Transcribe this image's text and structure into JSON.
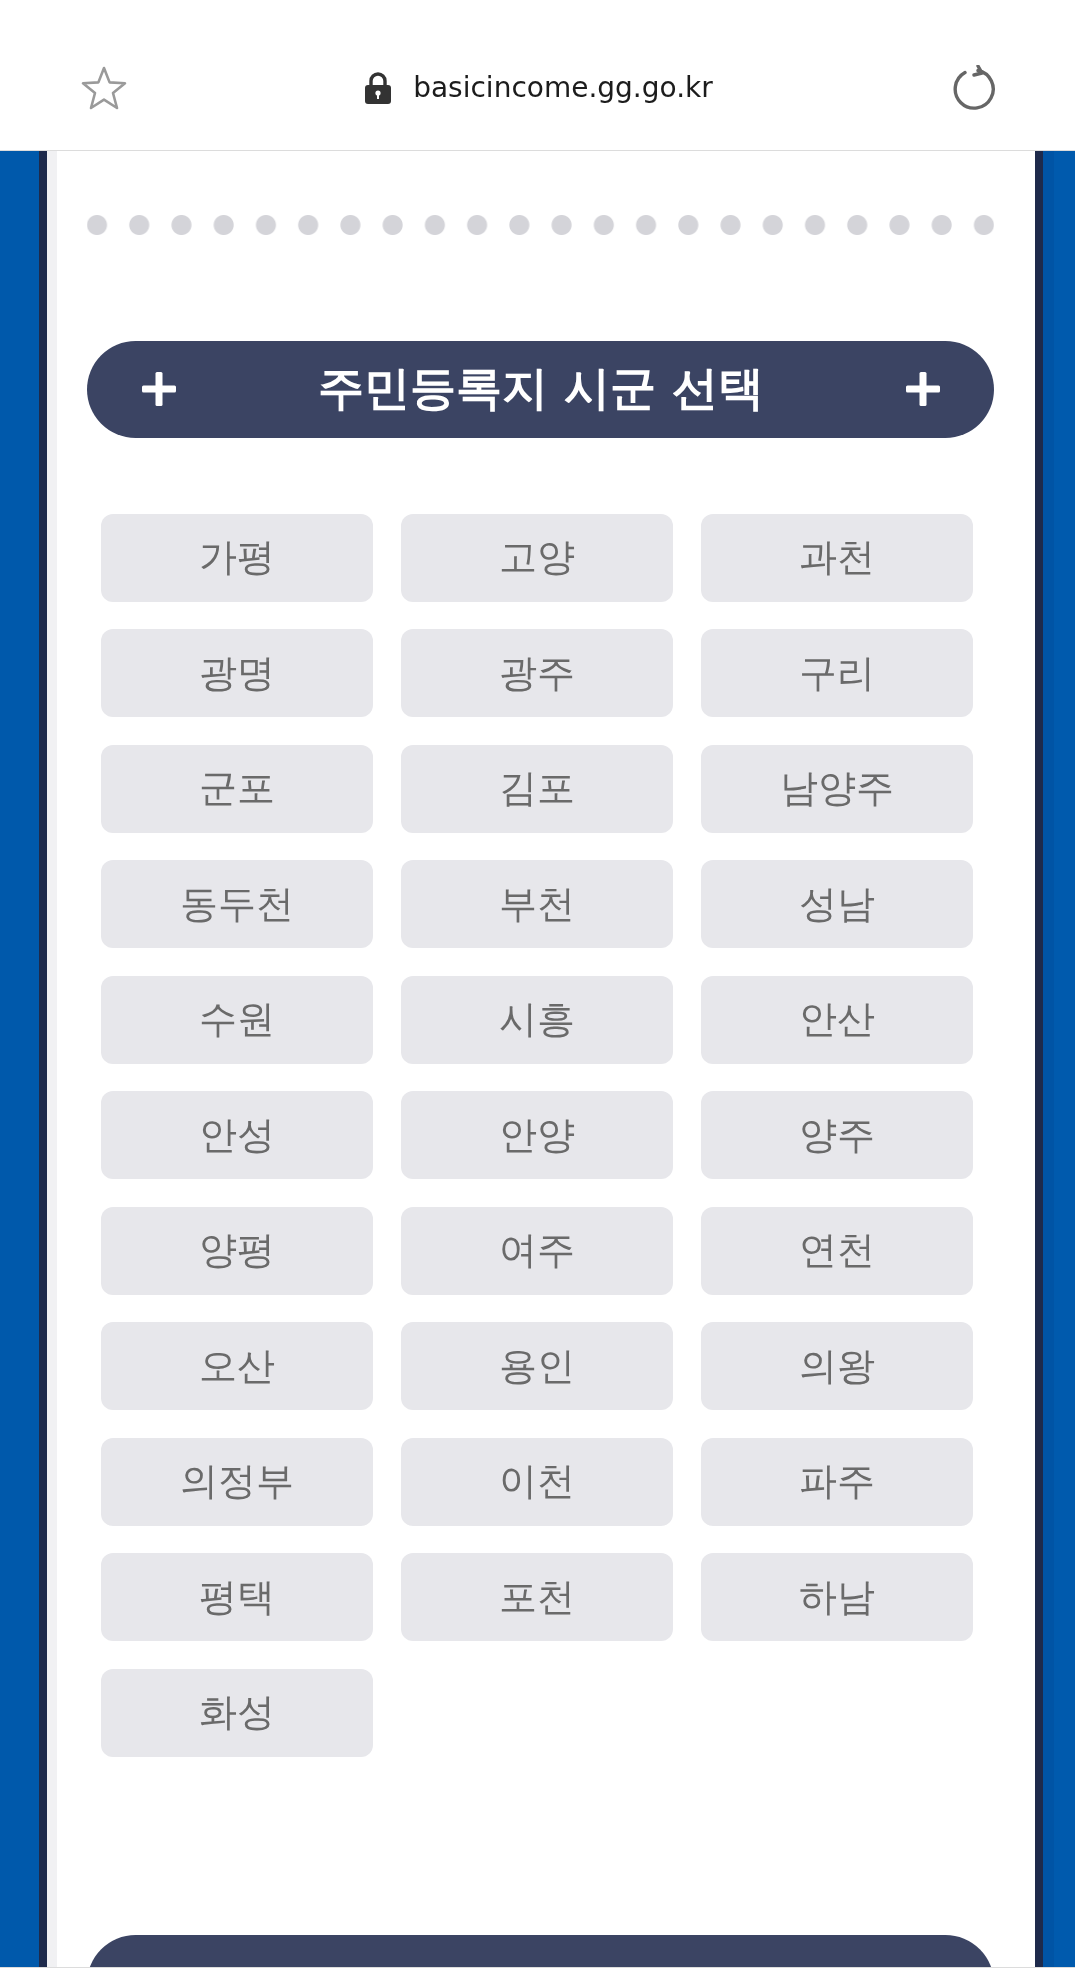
{
  "browser": {
    "url": "basicincome.gg.go.kr"
  },
  "section": {
    "title": "주민등록지 시군 선택",
    "districts": [
      "가평",
      "고양",
      "과천",
      "광명",
      "광주",
      "구리",
      "군포",
      "김포",
      "남양주",
      "동두천",
      "부천",
      "성남",
      "수원",
      "시흥",
      "안산",
      "안성",
      "안양",
      "양주",
      "양평",
      "여주",
      "연천",
      "오산",
      "용인",
      "의왕",
      "의정부",
      "이천",
      "파주",
      "평택",
      "포천",
      "하남",
      "화성"
    ]
  }
}
